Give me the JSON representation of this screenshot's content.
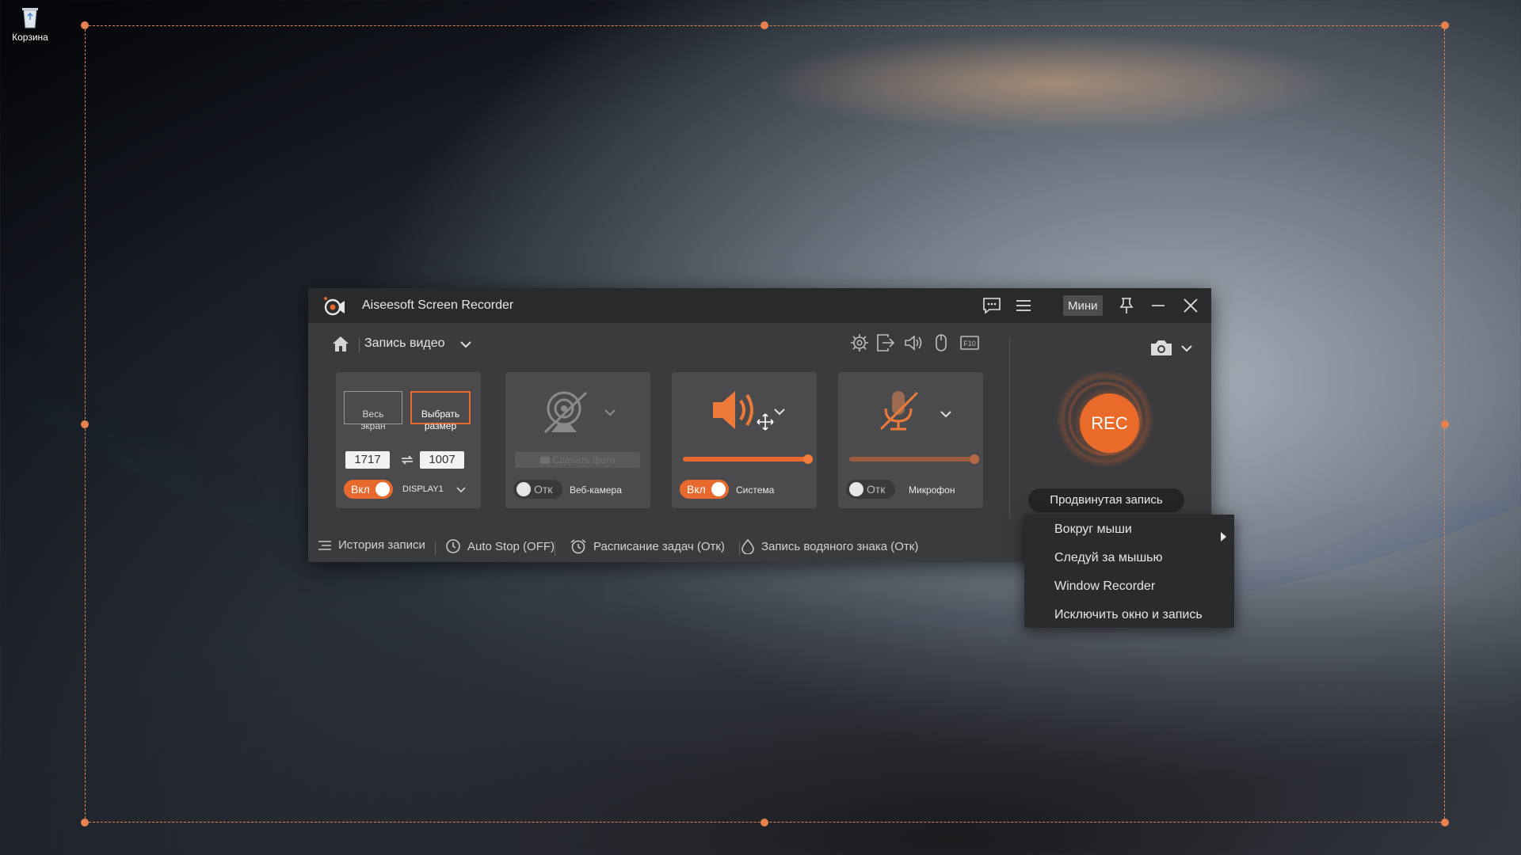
{
  "desktop": {
    "recycle_bin_label": "Корзина"
  },
  "app": {
    "title": "Aiseesoft Screen Recorder",
    "mini_label": "Мини",
    "mode_label": "Запись видео",
    "icons": {
      "logo": "recorder-logo-icon",
      "feedback": "chat-icon",
      "menu": "hamburger-icon",
      "pin": "pin-icon",
      "minimize": "minimize-icon",
      "close": "close-icon",
      "home": "home-icon",
      "settings": "gear-icon",
      "export": "export-icon",
      "speaker": "speaker-icon",
      "mouse": "mouse-icon",
      "hotkey": "hotkey-icon",
      "camera": "camera-icon"
    }
  },
  "display_card": {
    "full_screen_label": "Весь\nэкран",
    "custom_size_label": "Выбрать\nразмер",
    "width": "1717",
    "height": "1007",
    "toggle_label": "Вкл",
    "display_label": "DISPLAY1"
  },
  "webcam_card": {
    "snapshot_label": "Сделать фото",
    "toggle_label": "Отк",
    "label": "Веб-камера"
  },
  "system_card": {
    "toggle_label": "Вкл",
    "label": "Система",
    "volume": 1.0
  },
  "mic_card": {
    "toggle_label": "Отк",
    "label": "Микрофон",
    "volume": 1.0
  },
  "record": {
    "rec_label": "REC",
    "advanced_label": "Продвинутая запись"
  },
  "bottom_bar": {
    "history": "История записи",
    "auto_stop": "Auto Stop (OFF)",
    "schedule": "Расписание задач (Отк)",
    "watermark": "Запись водяного знака (Отк)"
  },
  "advanced_menu": {
    "items": [
      "Вокруг мыши",
      "Следуй за мышью",
      "Window Recorder",
      "Исключить окно и запись"
    ]
  },
  "colors": {
    "accent": "#e8692d",
    "frame": "#e8814d",
    "window_bg": "#3b3b3e",
    "card_bg": "#4b4b4e"
  }
}
